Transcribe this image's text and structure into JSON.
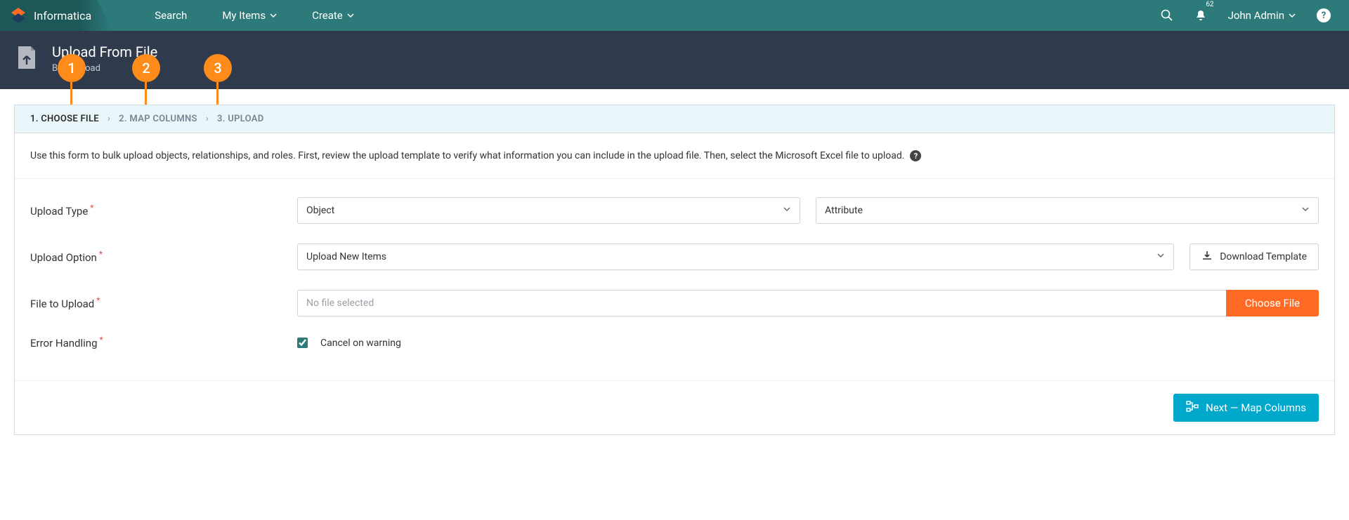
{
  "brand": {
    "name": "Informatica"
  },
  "nav": {
    "search": "Search",
    "my_items": "My Items",
    "create": "Create"
  },
  "nav_right": {
    "notif_count": "62",
    "user_name": "John Admin"
  },
  "page_header": {
    "title": "Upload From File",
    "subtitle": "Bulk Upload"
  },
  "callouts": {
    "c1": "1",
    "c2": "2",
    "c3": "3"
  },
  "wizard": {
    "step1": "1. CHOOSE FILE",
    "step2": "2. MAP COLUMNS",
    "step3": "3. UPLOAD"
  },
  "instruction": "Use this form to bulk upload objects, relationships, and roles. First, review the upload template to verify what information you can include in the upload file. Then, select the Microsoft Excel file to upload.",
  "form": {
    "upload_type_label": "Upload Type",
    "upload_type_value1": "Object",
    "upload_type_value2": "Attribute",
    "upload_option_label": "Upload Option",
    "upload_option_value": "Upload New Items",
    "download_template_label": "Download Template",
    "file_to_upload_label": "File to Upload",
    "file_placeholder": "No file selected",
    "choose_file_label": "Choose File",
    "error_handling_label": "Error Handling",
    "cancel_on_warning_label": "Cancel on warning"
  },
  "footer": {
    "next_label": "Next — Map Columns"
  }
}
